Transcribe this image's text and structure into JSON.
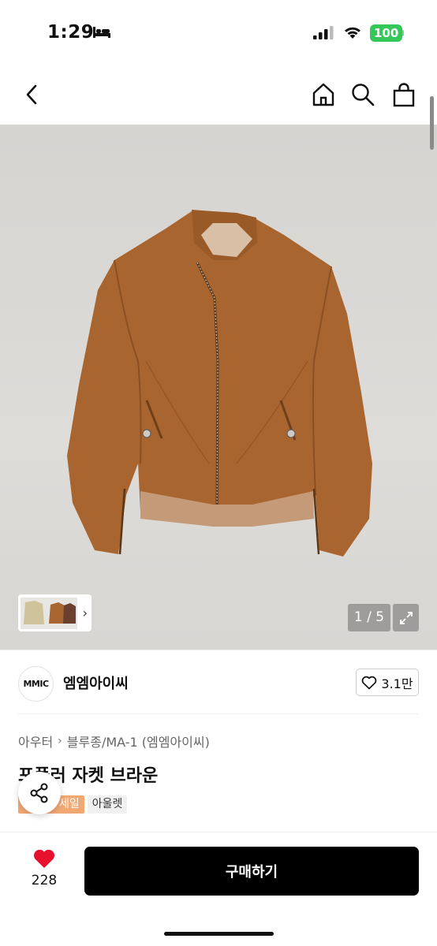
{
  "status_bar": {
    "time": "1:29",
    "battery": "100",
    "icons": [
      "bed-icon",
      "signal-icon",
      "wifi-icon"
    ]
  },
  "nav": {
    "icons": [
      "back-icon",
      "home-icon",
      "search-icon",
      "shopping-bag-icon"
    ]
  },
  "gallery": {
    "page_indicator": "1 / 5",
    "thumbnail_chevron": "›",
    "icons": [
      "expand-icon",
      "chevron-right-icon"
    ]
  },
  "brand": {
    "logo_text": "MMIC",
    "name": "엠엠아이씨",
    "likes": "3.1만"
  },
  "product": {
    "breadcrumb": [
      "아우터",
      "블루종/MA-1 (엠엠아이씨)"
    ],
    "breadcrumb_separator": "›",
    "title": "포플러 자켓 브라운",
    "tags": [
      "세일",
      "아울렛"
    ]
  },
  "bottom_bar": {
    "like_count": "228",
    "buy_label": "구매하기"
  },
  "colors": {
    "accent_black": "#000000",
    "heart_red": "#e8112d",
    "sale_tag": "#f2a873",
    "battery_green": "#34c759",
    "jacket_brown": "#a9652f"
  }
}
